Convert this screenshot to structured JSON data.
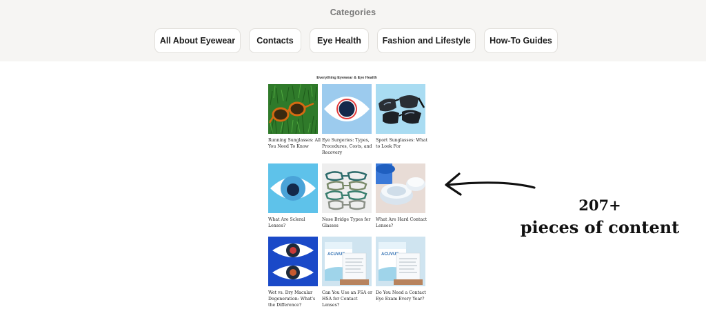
{
  "categories": {
    "title": "Categories",
    "items": [
      {
        "label": "All About Eyewear"
      },
      {
        "label": "Contacts"
      },
      {
        "label": "Eye Health"
      },
      {
        "label": "Fashion and Lifestyle"
      },
      {
        "label": "How-To Guides"
      }
    ]
  },
  "content_grid": {
    "title": "Everything Eyewear & Eye Health",
    "articles": [
      {
        "title": "Running Sunglasses: All You Need To Know"
      },
      {
        "title": "Eye Surgeries: Types, Procedures, Costs, and Recovery"
      },
      {
        "title": "Sport Sunglasses: What to Look For"
      },
      {
        "title": "What Are Scleral Lenses?"
      },
      {
        "title": "Nose Bridge Types for Glasses"
      },
      {
        "title": "What Are Hard Contact Lenses?"
      },
      {
        "title": "Wet vs. Dry Macular Degeneration: What's the Difference?"
      },
      {
        "title": "Can You Use an FSA or HSA for Contact Lenses?"
      },
      {
        "title": "Do You Need a Contact Eye Exam Every Year?"
      }
    ]
  },
  "annotation": {
    "count": "207+",
    "label": "pieces of content"
  },
  "colors": {
    "topbar_bg": "#f6f5f3",
    "pill_border": "#e1dfdb",
    "grass": "#2f7a2a",
    "sky_blue": "#9ccbee",
    "cyan": "#5ec2ea",
    "royal_blue": "#1a49c8",
    "navy": "#13294b"
  }
}
